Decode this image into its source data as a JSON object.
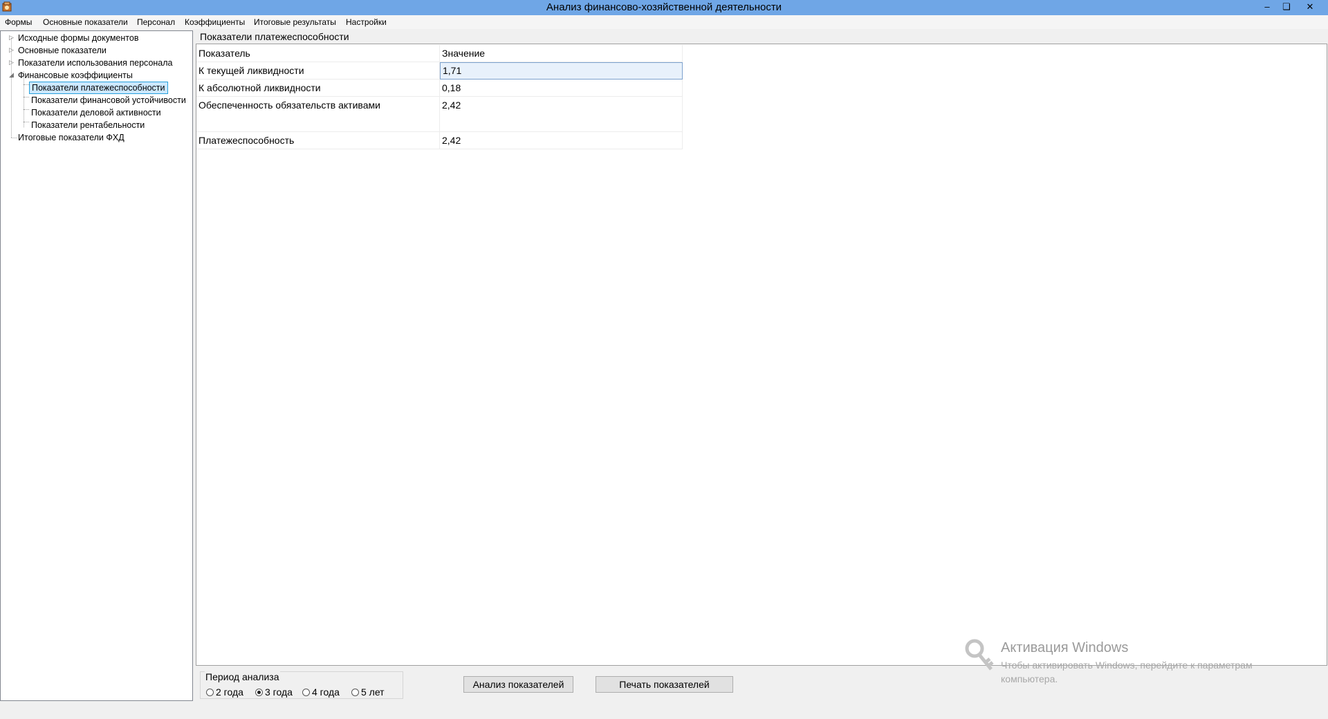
{
  "window": {
    "title": "Анализ финансово-хозяйственной деятельности"
  },
  "menu": [
    "Формы",
    "Основные показатели",
    "Персонал",
    "Коэффициенты",
    "Итоговые результаты",
    "Настройки"
  ],
  "tree": {
    "items": [
      "Исходные формы документов",
      "Основные показатели",
      "Показатели  использования персонала",
      "Финансовые коэффициенты",
      "Показатели платежеспособности",
      "Показатели финансовой устойчивости",
      "Показатели деловой активности",
      "Показатели рентабельности",
      "Итоговые показатели ФХД"
    ]
  },
  "panel": {
    "title": "Показатели платежеспособности"
  },
  "table": {
    "headers": [
      "Показатель",
      "Значение"
    ],
    "rows": [
      [
        "К текущей ликвидности",
        "1,71"
      ],
      [
        "К абсолютной ликвидности",
        "0,18"
      ],
      [
        "Обеспеченность обязательств активами",
        "2,42"
      ],
      [
        "Платежеспособность",
        "2,42"
      ]
    ]
  },
  "period": {
    "label": "Период анализа",
    "options": [
      "2 года",
      "3 года",
      "4 года",
      "5 лет"
    ],
    "selected": "3 года"
  },
  "buttons": {
    "analyze": "Анализ показателей",
    "print": "Печать показателей"
  },
  "watermark": {
    "title": "Активация Windows",
    "subtitle": "Чтобы активировать Windows, перейдите к параметрам компьютера."
  },
  "colors": {
    "titlebar": "#6fa6e6",
    "selection": "#cce8ff"
  }
}
